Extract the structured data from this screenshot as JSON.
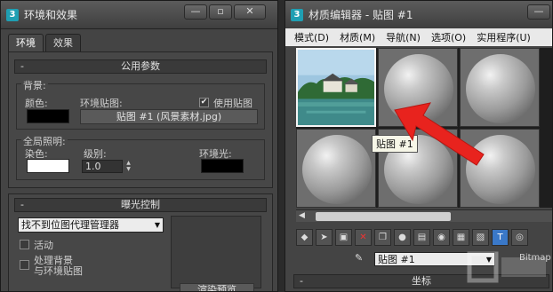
{
  "left_window": {
    "title": "环境和效果",
    "tabs": [
      "环境",
      "效果"
    ],
    "common_params": {
      "header": "公用参数",
      "background_group": "背景:",
      "color_label": "颜色:",
      "env_map_label": "环境贴图:",
      "use_map_label": "使用贴图",
      "use_map_checked": "✔",
      "map_button": "贴图 #1 (风景素材.jpg)",
      "global_lighting_group": "全局照明:",
      "tint_label": "染色:",
      "level_label": "级别:",
      "level_value": "1.0",
      "ambient_label": "环境光:"
    },
    "exposure": {
      "header": "曝光控制",
      "dropdown_value": "找不到位图代理管理器",
      "active_label": "活动",
      "process_bg_label": "处理背景\n与环境贴图",
      "render_preview": "渲染预览"
    },
    "colors": {
      "bg_color": "#000000",
      "tint_color": "#ffffff",
      "ambient_color": "#000000"
    }
  },
  "right_window": {
    "title": "材质编辑器 - 贴图 #1",
    "menu": [
      "模式(D)",
      "材质(M)",
      "导航(N)",
      "选项(O)",
      "实用程序(U)"
    ],
    "tooltip": "贴图 #1",
    "material_name": "贴图 #1",
    "map_type": "Bitmap",
    "coordinates_header": "坐标"
  },
  "window_buttons": {
    "minimize": "—",
    "maximize": "▫",
    "close": "✕"
  },
  "watermark": "下载吧"
}
